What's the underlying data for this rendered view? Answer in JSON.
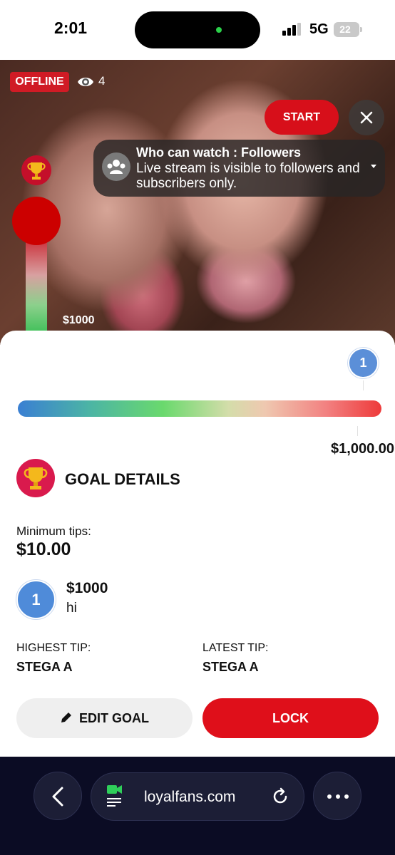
{
  "status_bar": {
    "time": "2:01",
    "network": "5G",
    "battery": "22"
  },
  "stream": {
    "status_badge": "OFFLINE",
    "viewer_count": "4",
    "start_label": "START",
    "visibility": {
      "title": "Who can watch : Followers",
      "description": "Live stream is visible to followers and subscribers only."
    },
    "thermometer_label": "$1000",
    "thermometer_fill": 0.0
  },
  "goal": {
    "marker_number": "1",
    "amount": "$1,000.00",
    "heading": "GOAL DETAILS",
    "min_tips_label": "Minimum tips:",
    "min_tips_value": "$10.00",
    "tips": [
      {
        "number": "1",
        "amount": "$1000",
        "message": "hi"
      }
    ],
    "highest_tip_label": "HIGHEST TIP:",
    "highest_tip_value": "STEGA A",
    "latest_tip_label": "LATEST TIP:",
    "latest_tip_value": "STEGA A",
    "edit_label": "EDIT GOAL",
    "lock_label": "LOCK"
  },
  "browser": {
    "url": "loyalfans.com"
  },
  "colors": {
    "accent_red": "#d70f1a",
    "marker_blue": "#4f8bd9",
    "browser_bg": "#0b0c24"
  },
  "icons": [
    "eye-icon",
    "close-icon",
    "group-icon",
    "trophy-icon",
    "pencil-icon",
    "back-icon",
    "video-site-icon",
    "reload-icon",
    "more-icon",
    "signal-icon",
    "battery-icon"
  ]
}
